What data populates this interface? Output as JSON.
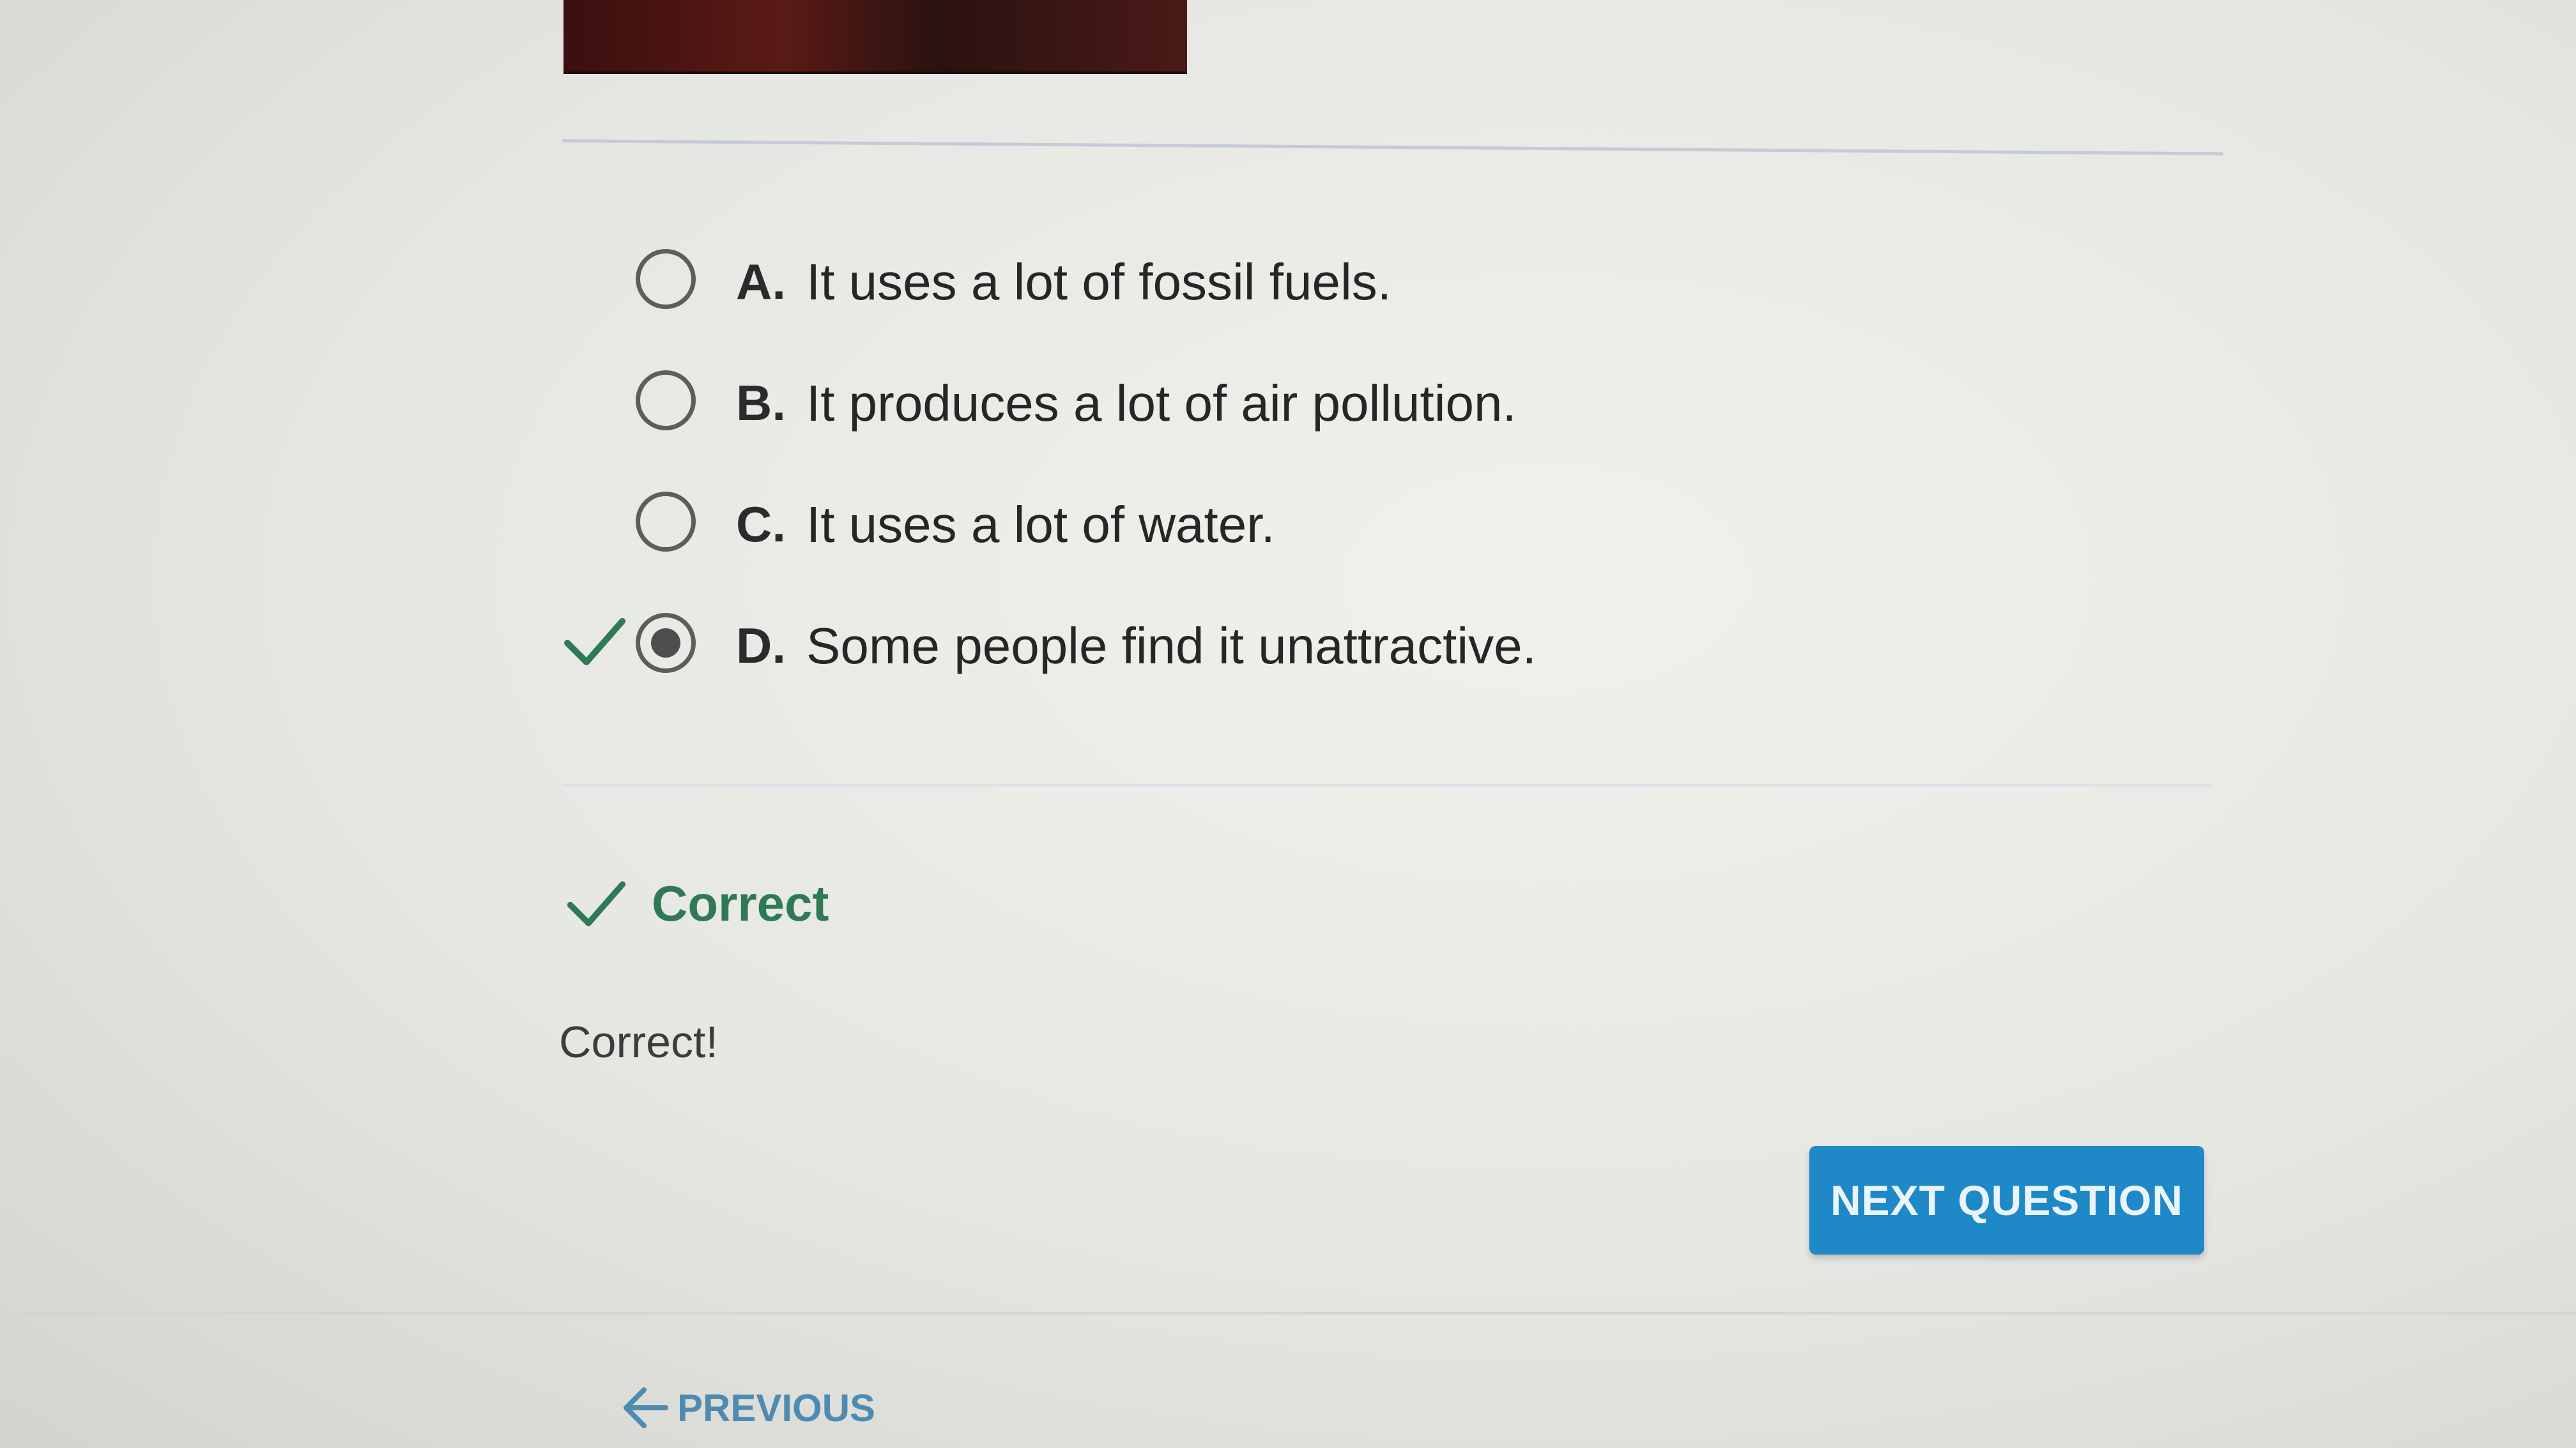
{
  "question": {
    "choices": [
      {
        "letter": "A.",
        "text": "It uses a lot of fossil fuels.",
        "selected": false,
        "marked_correct": false
      },
      {
        "letter": "B.",
        "text": "It produces a lot of air pollution.",
        "selected": false,
        "marked_correct": false
      },
      {
        "letter": "C.",
        "text": "It uses a lot of water.",
        "selected": false,
        "marked_correct": false
      },
      {
        "letter": "D.",
        "text": "Some people find it unattractive.",
        "selected": true,
        "marked_correct": true
      }
    ]
  },
  "result": {
    "label": "Correct",
    "feedback": "Correct!"
  },
  "nav": {
    "next_label": "NEXT QUESTION",
    "previous_label": "PREVIOUS"
  },
  "colors": {
    "correct_green": "#2f7a54",
    "button_blue": "#1f88c6",
    "link_blue": "#4f8bb0"
  },
  "icons": {
    "correct_mark": "checkmark-icon",
    "previous": "arrow-left-icon"
  }
}
